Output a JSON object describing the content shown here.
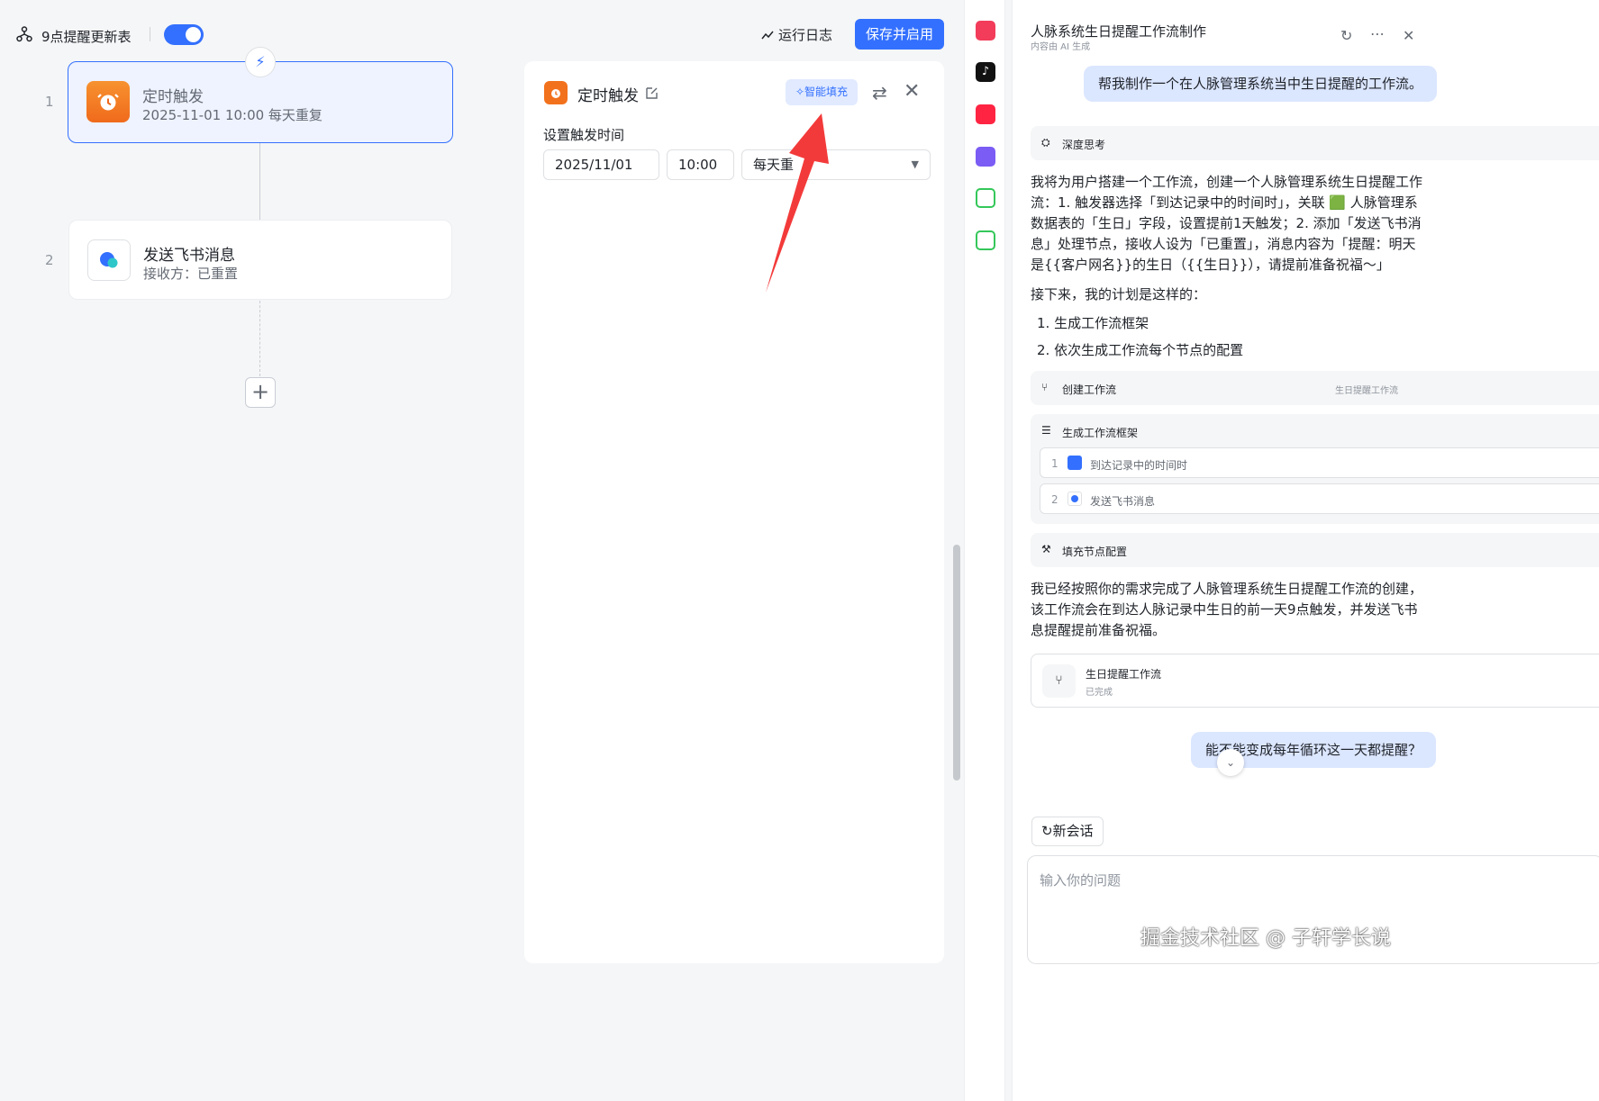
{
  "topbar": {
    "workflow_name": "9点提醒更新表",
    "run_log": "运行日志",
    "save_enable": "保存并启用"
  },
  "nodes": [
    {
      "index": "1",
      "title": "定时触发",
      "subtitle": "2025-11-01 10:00 每天重复"
    },
    {
      "index": "2",
      "title": "发送飞书消息",
      "subtitle": "接收方：已重置"
    }
  ],
  "panel": {
    "title": "定时触发",
    "smart_fill": "智能填充",
    "section_label": "设置触发时间",
    "date_value": "2025/11/01",
    "time_value": "10:00",
    "repeat_value": "每天重"
  },
  "rail": {
    "icons": [
      "app-icon",
      "douyin-icon",
      "xiaohongshu-icon",
      "bookmark-app-icon",
      "calendar-app-icon",
      "markdown-app-icon"
    ],
    "colors": [
      "#f23c5a",
      "#111111",
      "#ff2442",
      "#7b5cf5",
      "#34c759",
      "#34c759"
    ]
  },
  "chat": {
    "title": "人脉系统生日提醒工作流制作",
    "subtitle": "内容由 AI 生成",
    "user_msg_1": "帮我制作一个在人脉管理系统当中生日提醒的工作流。",
    "deep_think": "深度思考",
    "reply_1": [
      "我将为用户搭建一个工作流，创建一个人脉管理系统生日提醒工作",
      "流：1. 触发器选择「到达记录中的时间时」，关联 🟩 人脉管理系",
      "数据表的「生日」字段，设置提前1天触发；2. 添加「发送飞书消",
      "息」处理节点，接收人设为「已重置」，消息内容为「提醒：明天",
      "是{{客户网名}}的生日（{{生日}}），请提前准备祝福～」"
    ],
    "plan_intro": "接下来，我的计划是这样的：",
    "plan_items": [
      "1.  生成工作流框架",
      "2.  依次生成工作流每个节点的配置"
    ],
    "create_workflow": "创建工作流",
    "create_workflow_tag": "生日提醒工作流",
    "gen_framework": "生成工作流框架",
    "framework_items": [
      {
        "num": "1",
        "label": "到达记录中的时间时"
      },
      {
        "num": "2",
        "label": "发送飞书消息"
      }
    ],
    "fill_config": "填充节点配置",
    "reply_2": [
      "我已经按照你的需求完成了人脉管理系统生日提醒工作流的创建，",
      "该工作流会在到达人脉记录中生日的前一天9点触发，并发送飞书",
      "息提醒提前准备祝福。"
    ],
    "card_title": "生日提醒工作流",
    "card_status": "已完成",
    "user_msg_2": "能不能变成每年循环这一天都提醒？",
    "new_session": "新会话",
    "input_placeholder": "输入你的问题"
  },
  "watermark": "掘金技术社区 @ 子轩学长说"
}
